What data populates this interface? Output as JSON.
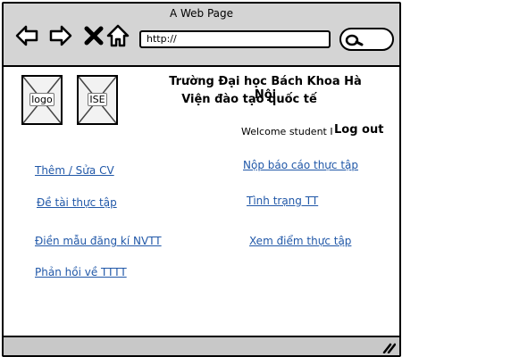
{
  "window": {
    "title": "A Web Page"
  },
  "toolbar": {
    "back_icon": "arrow-left-icon",
    "forward_icon": "arrow-right-icon",
    "close_icon": "x-icon",
    "home_icon": "home-icon",
    "url": "http://",
    "search_icon": "search-icon"
  },
  "header": {
    "logo_label": "logo",
    "ise_label": "ISE",
    "university": "Trường Đại học Bách Khoa Hà Nội",
    "institute": "Viện đào tạo quốc tế"
  },
  "user": {
    "welcome": "Welcome student I",
    "logout": "Log out"
  },
  "links": {
    "left": [
      "Thêm / Sửa CV",
      "Đề tài thực tập",
      "Điền mẫu đăng kí NVTT",
      "Phản hồi về TTTT"
    ],
    "right": [
      "Nộp báo cáo thực tập",
      "Tình trạng TT",
      "Xem điểm thực tập"
    ]
  },
  "colors": {
    "link": "#2158a8",
    "chrome": "#d4d4d4",
    "statusbar": "#c8c8c8"
  }
}
